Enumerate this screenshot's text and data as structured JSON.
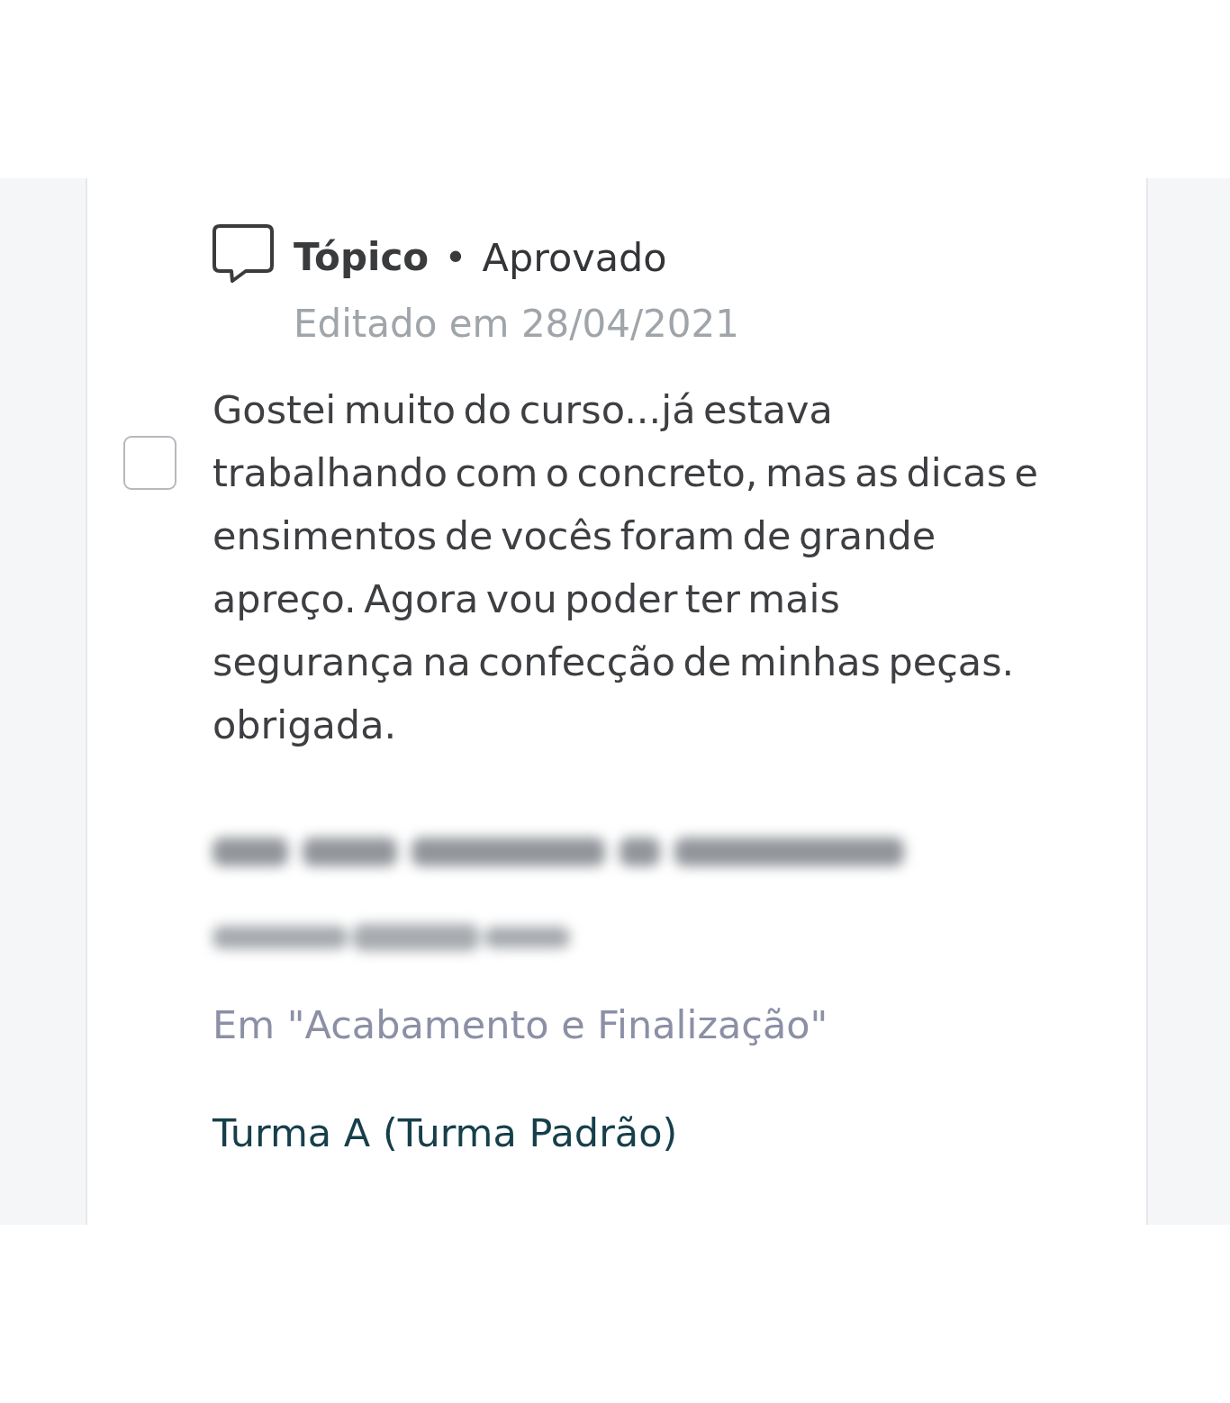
{
  "post": {
    "type_label": "Tópico",
    "separator": "•",
    "status": "Aprovado",
    "edited": "Editado em 28/04/2021",
    "checkbox": {
      "checked": false
    },
    "body": "Gostei muito do curso...já estava trabalhando com o concreto, mas as dicas e ensimentos de vocês foram de grande apreço. Agora vou poder ter mais segurança na confecção de minhas peças. obrigada.",
    "author": {
      "name_redacted": true,
      "email_redacted": true
    },
    "location": "Em \"Acabamento e Finalização\"",
    "group": "Turma A (Turma Padrão)"
  }
}
